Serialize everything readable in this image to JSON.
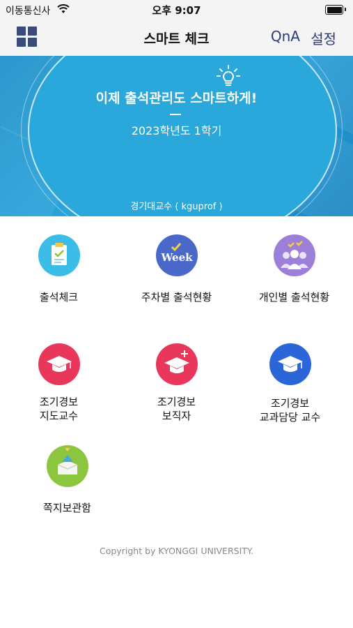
{
  "status_bar": {
    "carrier": "이동통신사",
    "time": "오후 9:07"
  },
  "nav": {
    "title": "스마트 체크",
    "qna_label": "QnA",
    "settings_label": "설정"
  },
  "banner": {
    "headline": "이제 출석관리도 스마트하게!",
    "semester": "2023학년도 1학기",
    "user": "경기대교수 ( kguprof )"
  },
  "menu": {
    "items": [
      {
        "label": "출석체크",
        "icon": "clipboard-check-icon",
        "color": "#3bbde8"
      },
      {
        "label": "주차별 출석현황",
        "icon": "week-icon",
        "color": "#4a68c9"
      },
      {
        "label": "개인별 출석현황",
        "icon": "people-check-icon",
        "color": "#9b7fd8"
      },
      {
        "label": "조기경보\n지도교수",
        "icon": "graduation-cap-icon",
        "color": "#e8375a"
      },
      {
        "label": "조기경보\n보직자",
        "icon": "graduation-cap-plus-icon",
        "color": "#e8375a"
      },
      {
        "label": "조기경보\n교과담당 교수",
        "icon": "graduation-cap-blue-icon",
        "color": "#2a66d8"
      },
      {
        "label": "쪽지보관함",
        "icon": "message-box-icon",
        "color": "#8cc63f"
      }
    ]
  },
  "footer": {
    "copyright": "Copyright by KYONGGI UNIVERSITY."
  }
}
